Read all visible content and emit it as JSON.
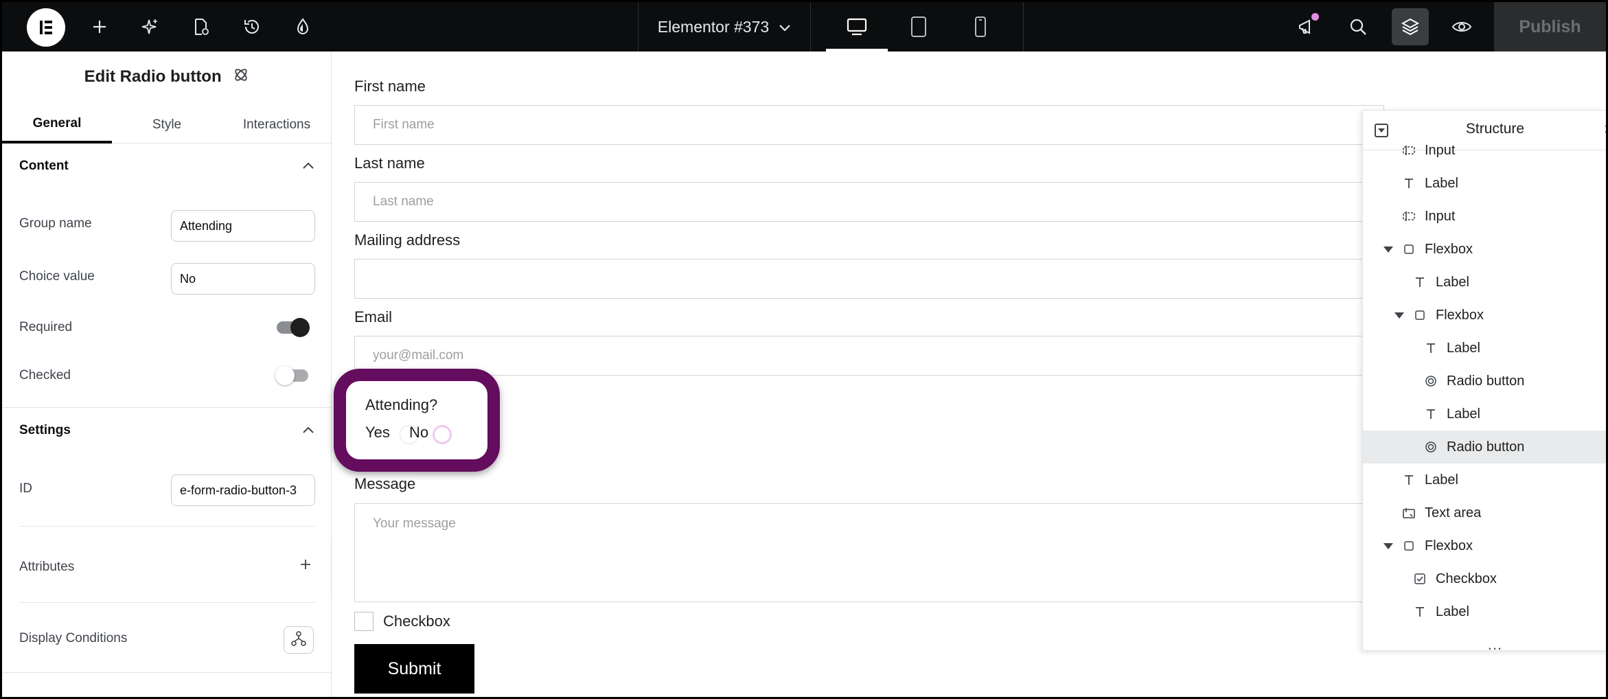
{
  "topbar": {
    "document_title": "Elementor #373",
    "publish_label": "Publish",
    "icons": [
      "elementor-logo-icon",
      "add-icon",
      "ai-sparkle-icon",
      "page-settings-icon",
      "history-icon",
      "site-settings-icon",
      "desktop-icon",
      "tablet-icon",
      "mobile-icon",
      "notifications-icon",
      "search-icon",
      "structure-icon",
      "preview-icon"
    ]
  },
  "panel": {
    "title": "Edit Radio button",
    "tabs": [
      "General",
      "Style",
      "Interactions"
    ],
    "content_section": "Content",
    "group_name_label": "Group name",
    "group_name_value": "Attending",
    "choice_value_label": "Choice value",
    "choice_value_value": "No",
    "required_label": "Required",
    "required_on": true,
    "checked_label": "Checked",
    "checked_on": false,
    "settings_section": "Settings",
    "id_label": "ID",
    "id_value": "e-form-radio-button-3",
    "attributes_label": "Attributes",
    "display_conditions_label": "Display Conditions"
  },
  "form": {
    "first_name_label": "First name",
    "first_name_placeholder": "First name",
    "last_name_label": "Last name",
    "last_name_placeholder": "Last name",
    "mailing_label": "Mailing address",
    "mailing_placeholder": "",
    "email_label": "Email",
    "email_placeholder": "your@mail.com",
    "attending_label": "Attending?",
    "yes_label": "Yes",
    "no_label": "No",
    "message_label": "Message",
    "message_placeholder": "Your message",
    "checkbox_label": "Checkbox",
    "submit_label": "Submit",
    "highlight_color": "#640c5e"
  },
  "structure": {
    "title": "Structure",
    "items": [
      {
        "label": "Input",
        "icon": "input-icon",
        "indent": 1
      },
      {
        "label": "Label",
        "icon": "text-icon",
        "indent": 1
      },
      {
        "label": "Input",
        "icon": "input-icon",
        "indent": 1
      },
      {
        "label": "Flexbox",
        "icon": "flexbox-icon",
        "indent": 1,
        "expanded": true
      },
      {
        "label": "Label",
        "icon": "text-icon",
        "indent": 2
      },
      {
        "label": "Flexbox",
        "icon": "flexbox-icon",
        "indent": 2,
        "expanded": true
      },
      {
        "label": "Label",
        "icon": "text-icon",
        "indent": 3
      },
      {
        "label": "Radio button",
        "icon": "radio-icon",
        "indent": 3
      },
      {
        "label": "Label",
        "icon": "text-icon",
        "indent": 3
      },
      {
        "label": "Radio button",
        "icon": "radio-icon",
        "indent": 3,
        "selected": true
      },
      {
        "label": "Label",
        "icon": "text-icon",
        "indent": 1
      },
      {
        "label": "Text area",
        "icon": "textarea-icon",
        "indent": 1
      },
      {
        "label": "Flexbox",
        "icon": "flexbox-icon",
        "indent": 1,
        "expanded": true
      },
      {
        "label": "Checkbox",
        "icon": "checkbox-icon",
        "indent": 2
      },
      {
        "label": "Label",
        "icon": "text-icon",
        "indent": 2
      }
    ],
    "more": "..."
  }
}
